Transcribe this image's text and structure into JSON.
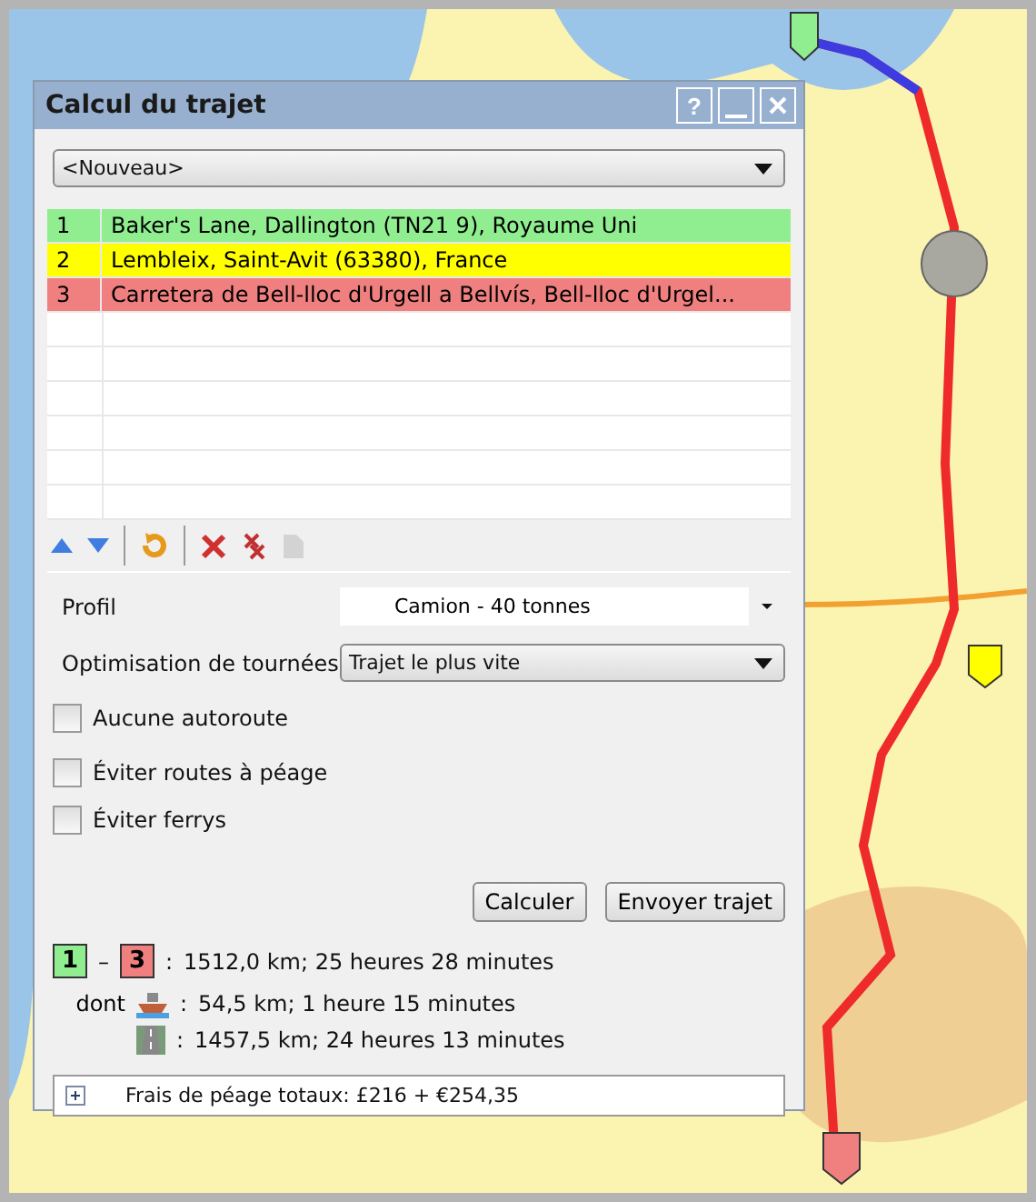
{
  "window": {
    "title": "Calcul du trajet",
    "help": "?"
  },
  "route_select": {
    "value": "<Nouveau>"
  },
  "waypoints": [
    {
      "index": "1",
      "address": "Baker's Lane, Dallington (TN21 9), Royaume Uni",
      "color": "#90ee90"
    },
    {
      "index": "2",
      "address": "Lembleix, Saint-Avit (63380), France",
      "color": "#ffff00"
    },
    {
      "index": "3",
      "address": "Carretera de Bell-lloc d'Urgell a Bellvís, Bell-lloc d'Urgel...",
      "color": "#f08080"
    }
  ],
  "toolbar": [
    {
      "kind": "up",
      "disabled": false
    },
    {
      "kind": "down",
      "disabled": false
    },
    {
      "kind": "sep"
    },
    {
      "kind": "reverse",
      "disabled": false
    },
    {
      "kind": "sep"
    },
    {
      "kind": "delete",
      "disabled": false
    },
    {
      "kind": "delete_all",
      "disabled": false
    },
    {
      "kind": "copy",
      "disabled": true
    }
  ],
  "profile": {
    "label": "Profil",
    "value": "Camion - 40 tonnes"
  },
  "optimisation": {
    "label": "Optimisation de tournées",
    "value": "Trajet le plus vite"
  },
  "options": [
    {
      "label": "Aucune autoroute",
      "checked": false
    },
    {
      "label": "Éviter routes à péage",
      "checked": false
    },
    {
      "label": "Éviter ferrys",
      "checked": false
    }
  ],
  "buttons": [
    "Calculer",
    "Envoyer trajet"
  ],
  "summary": {
    "from": {
      "text": "1",
      "color": "#90ee90"
    },
    "dash": "–",
    "to": {
      "text": "3",
      "color": "#f08080"
    },
    "colon": ":",
    "total": "1512,0 km; 25 heures 28 minutes",
    "dont": "dont",
    "parts": [
      {
        "kind": "ferry",
        "colon": ":",
        "text": "54,5 km; 1 heure 15 minutes"
      },
      {
        "kind": "road",
        "colon": ":",
        "text": "1457,5 km; 24 heures 13 minutes"
      }
    ]
  },
  "tolls": {
    "expanded": false,
    "text": "Frais de péage totaux: £216 + €254,35"
  }
}
